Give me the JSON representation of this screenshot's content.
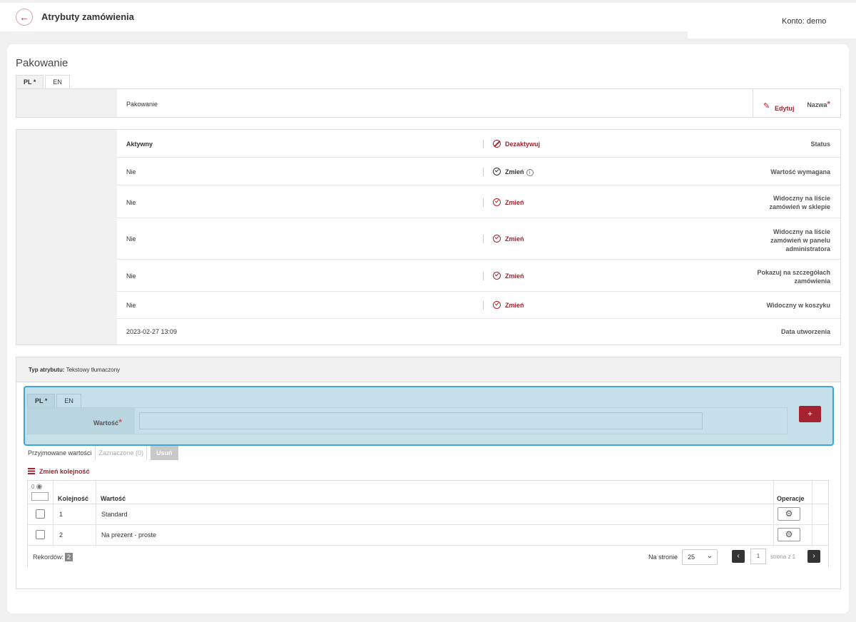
{
  "header": {
    "back_icon": "arrow-left-icon",
    "title": "Atrybuty zamówienia",
    "account": "Konto: demo"
  },
  "section": {
    "title": "Pakowanie",
    "tabs": [
      {
        "label": "PL *",
        "active": true
      },
      {
        "label": "EN",
        "active": false
      }
    ],
    "name_label": "Nazwa",
    "name_value": "Pakowanie",
    "edit_label": "Edytuj"
  },
  "status_rows": [
    {
      "label": "Status",
      "value": "Aktywny",
      "action": "Dezaktywuj",
      "icon": "ban-icon"
    },
    {
      "label": "Wartość wymagana",
      "value": "Nie",
      "action": "Zmień",
      "icon": "check-circle-icon"
    },
    {
      "label": "Widoczny na liście zamówień w sklepie",
      "value": "Nie",
      "action": "Zmień",
      "icon": "check-circle-icon"
    },
    {
      "label": "Widoczny na liście zamówień w panelu administratora",
      "value": "Nie",
      "action": "Zmień",
      "icon": "check-circle-icon"
    },
    {
      "label": "Pokazuj na szczegółach zamówienia",
      "value": "Nie",
      "action": "Zmień",
      "icon": "check-circle-icon"
    },
    {
      "label": "Widoczny w koszyku",
      "value": "Nie",
      "action": "Zmień",
      "icon": "check-circle-icon"
    },
    {
      "label": "Data utworzenia",
      "value": "2023-02-27 13:09"
    }
  ],
  "type_bar": {
    "label": "Typ atrybutu:",
    "value": "Tekstowy tłumaczony"
  },
  "value_form": {
    "tabs": [
      {
        "label": "PL *"
      },
      {
        "label": "EN"
      }
    ],
    "label": "Wartość",
    "input_value": "",
    "add_label": "+"
  },
  "subtabs": {
    "accepted": "Przyjmowane wartości",
    "selected": "Zaznaczone (0)",
    "delete": "Usuń"
  },
  "reorder_label": "Zmień kolejność",
  "table": {
    "selected_count": "0",
    "columns": [
      "Kolejność",
      "Wartość",
      "Operacje"
    ],
    "rows": [
      {
        "order": "1",
        "value": "Standard"
      },
      {
        "order": "2",
        "value": "Na prezent - proste"
      }
    ],
    "records_label": "Rekordów:",
    "records_count": "2",
    "per_page_label": "Na stronie",
    "per_page": "25",
    "page": "1",
    "page_of": "strona z 1"
  }
}
